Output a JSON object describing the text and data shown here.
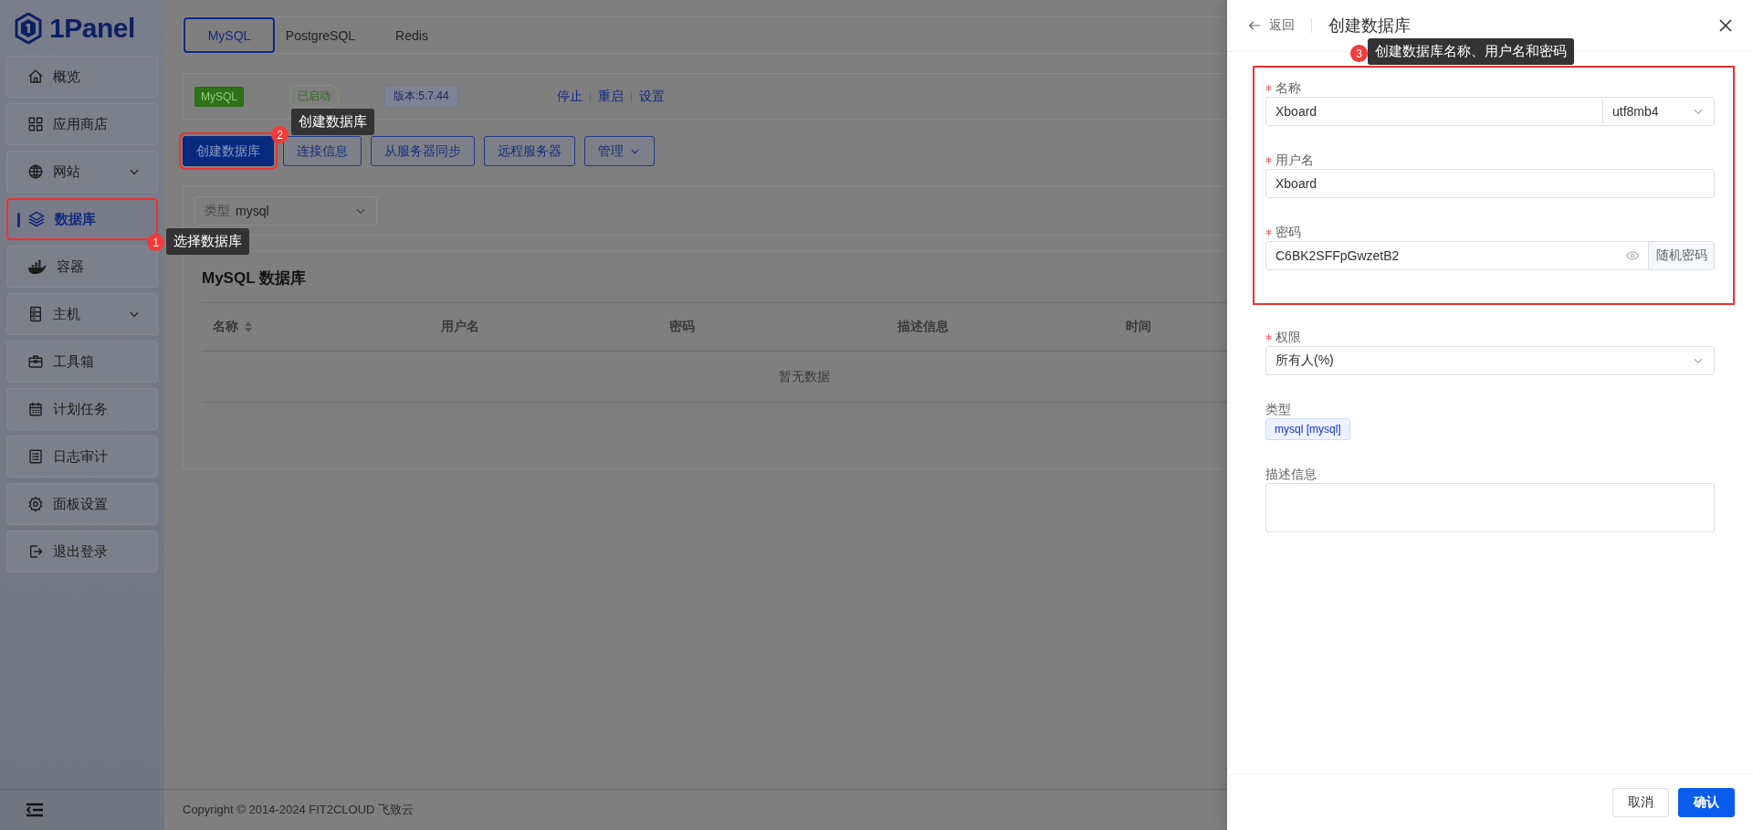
{
  "logo": {
    "text": "1Panel"
  },
  "sidebar": {
    "items": [
      {
        "label": "概览",
        "expandable": false,
        "selected": false
      },
      {
        "label": "应用商店",
        "expandable": false,
        "selected": false
      },
      {
        "label": "网站",
        "expandable": true,
        "selected": false
      },
      {
        "label": "数据库",
        "expandable": false,
        "selected": true,
        "annotation": {
          "number": "1",
          "text": "选择数据库"
        }
      },
      {
        "label": "容器",
        "expandable": false,
        "selected": false
      },
      {
        "label": "主机",
        "expandable": true,
        "selected": false
      },
      {
        "label": "工具箱",
        "expandable": false,
        "selected": false
      },
      {
        "label": "计划任务",
        "expandable": false,
        "selected": false
      },
      {
        "label": "日志审计",
        "expandable": false,
        "selected": false
      },
      {
        "label": "面板设置",
        "expandable": false,
        "selected": false
      },
      {
        "label": "退出登录",
        "expandable": false,
        "selected": false
      }
    ]
  },
  "db_tabs": [
    {
      "label": "MySQL",
      "selected": true
    },
    {
      "label": "PostgreSQL",
      "selected": false
    },
    {
      "label": "Redis",
      "selected": false
    }
  ],
  "status_bar": {
    "app_tag": "MySQL",
    "status": "已启动",
    "version": "版本:5.7.44",
    "actions": [
      "停止",
      "重启",
      "设置"
    ]
  },
  "toolbar": {
    "buttons": [
      {
        "label": "创建数据库",
        "kind": "primary",
        "annotation": {
          "number": "2",
          "text": "创建数据库"
        }
      },
      {
        "label": "连接信息",
        "kind": "plain"
      },
      {
        "label": "从服务器同步",
        "kind": "plain"
      },
      {
        "label": "远程服务器",
        "kind": "plain"
      },
      {
        "label": "管理",
        "kind": "dropdown"
      }
    ]
  },
  "filter": {
    "prefix": "类型",
    "value": "mysql"
  },
  "table": {
    "title": "MySQL 数据库",
    "columns": [
      {
        "label": "名称",
        "sortable": true
      },
      {
        "label": "用户名",
        "sortable": false
      },
      {
        "label": "密码",
        "sortable": false
      },
      {
        "label": "描述信息",
        "sortable": false
      },
      {
        "label": "时间",
        "sortable": false
      }
    ],
    "empty_text": "暂无数据"
  },
  "footer": "Copyright © 2014-2024 FIT2CLOUD 飞致云",
  "drawer": {
    "back": "返回",
    "title": "创建数据库",
    "groups": [
      {
        "annotation": {
          "number": "3",
          "text": "创建数据库名称、用户名和密码"
        },
        "fields": [
          {
            "label": "名称",
            "required": true,
            "kind": "input_select",
            "value": "Xboard",
            "select_value": "utf8mb4"
          },
          {
            "label": "用户名",
            "required": true,
            "kind": "input",
            "value": "Xboard"
          },
          {
            "label": "密码",
            "required": true,
            "kind": "password",
            "value": "C6BK2SFFpGwzetB2",
            "button": "随机密码"
          }
        ]
      },
      {
        "fields": [
          {
            "label": "权限",
            "required": true,
            "kind": "select",
            "value": "所有人(%)"
          },
          {
            "label": "类型",
            "required": false,
            "kind": "tag",
            "value": "mysql [mysql]"
          },
          {
            "label": "描述信息",
            "required": false,
            "kind": "textarea"
          }
        ]
      }
    ],
    "buttons": [
      {
        "label": "取消",
        "kind": "plain"
      },
      {
        "label": "确认",
        "kind": "primary"
      }
    ]
  }
}
